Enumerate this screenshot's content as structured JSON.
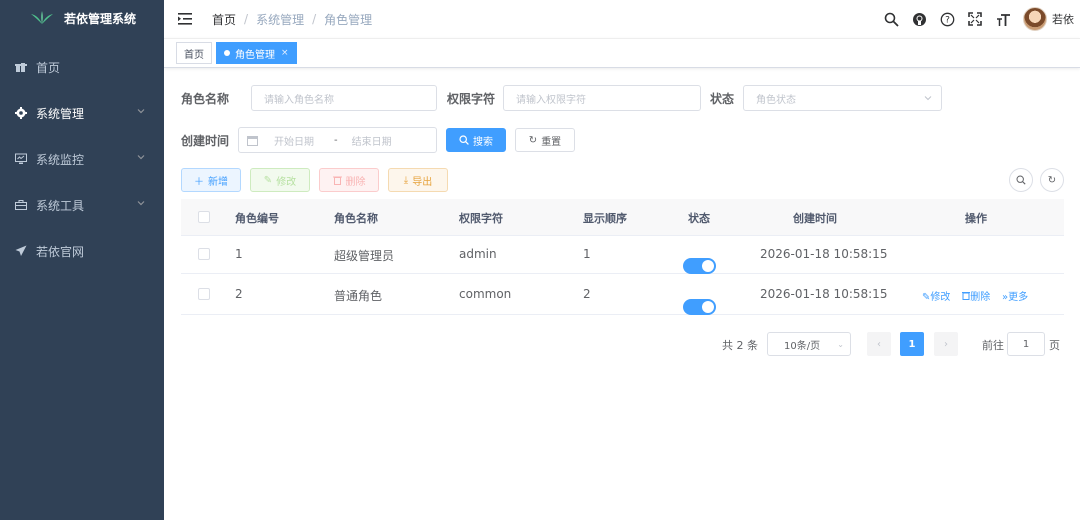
{
  "app": {
    "title": "若依管理系统"
  },
  "sidebar": {
    "items": [
      {
        "label": "首页",
        "icon": "dashboard-icon",
        "has_children": false
      },
      {
        "label": "系统管理",
        "icon": "gear-icon",
        "has_children": true
      },
      {
        "label": "系统监控",
        "icon": "monitor-icon",
        "has_children": true
      },
      {
        "label": "系统工具",
        "icon": "toolbox-icon",
        "has_children": true
      },
      {
        "label": "若依官网",
        "icon": "send-icon",
        "has_children": false
      }
    ]
  },
  "header": {
    "breadcrumb": [
      "首页",
      "系统管理",
      "角色管理"
    ],
    "username": "若依"
  },
  "tags": [
    {
      "label": "首页",
      "active": false
    },
    {
      "label": "角色管理",
      "active": true
    }
  ],
  "search": {
    "role_name_label": "角色名称",
    "role_name_placeholder": "请输入角色名称",
    "role_key_label": "权限字符",
    "role_key_placeholder": "请输入权限字符",
    "status_label": "状态",
    "status_placeholder": "角色状态",
    "created_label": "创建时间",
    "start_placeholder": "开始日期",
    "range_sep": "-",
    "end_placeholder": "结束日期",
    "search_button": "搜索",
    "reset_button": "重置"
  },
  "toolbar": {
    "add": "新增",
    "edit": "修改",
    "delete": "删除",
    "export": "导出"
  },
  "table": {
    "columns": [
      "角色编号",
      "角色名称",
      "权限字符",
      "显示顺序",
      "状态",
      "创建时间",
      "操作"
    ],
    "rows": [
      {
        "id": "1",
        "name": "超级管理员",
        "key": "admin",
        "sort": "1",
        "enabled": true,
        "created": "2026-01-18 10:58:15",
        "actions": []
      },
      {
        "id": "2",
        "name": "普通角色",
        "key": "common",
        "sort": "2",
        "enabled": true,
        "created": "2026-01-18 10:58:15",
        "actions": [
          "修改",
          "删除",
          "更多"
        ]
      }
    ]
  },
  "pagination": {
    "total_text": "共 2 条",
    "page_size": "10条/页",
    "current_page": "1",
    "goto_label": "前往",
    "goto_value": "1",
    "page_suffix": "页"
  },
  "colors": {
    "sidebar": "#304156",
    "primary": "#409eff"
  }
}
